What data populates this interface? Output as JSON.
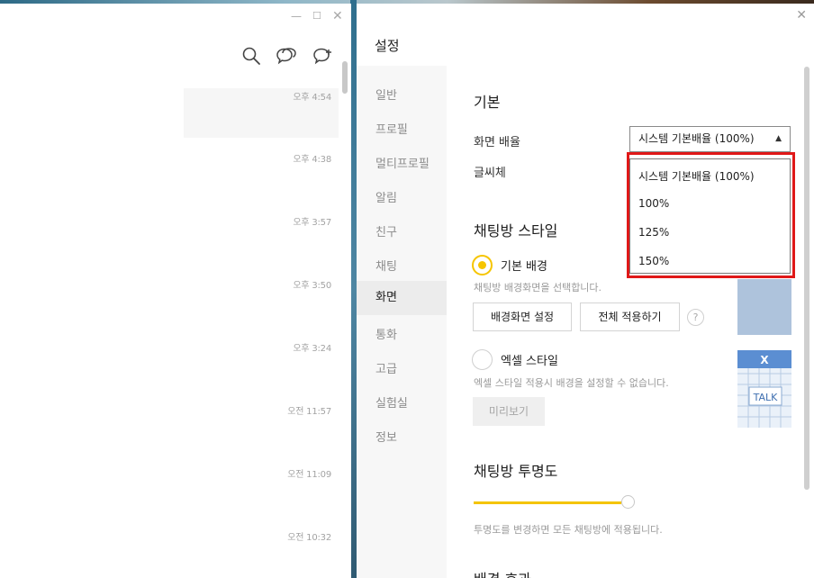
{
  "chat_window": {
    "controls": {
      "minimize": "—",
      "maximize": "☐",
      "close": "✕"
    },
    "toolbar_icons": [
      "search-icon",
      "openchat-icon",
      "new-chat-icon"
    ],
    "times": [
      "오후 4:54",
      "오후 4:38",
      "오후 3:57",
      "오후 3:50",
      "오후 3:24",
      "오전 11:57",
      "오전 11:09",
      "오전 10:32"
    ]
  },
  "settings": {
    "title": "설정",
    "close": "✕",
    "sidebar": [
      "일반",
      "프로필",
      "멀티프로필",
      "알림",
      "친구",
      "채팅",
      "화면",
      "통화",
      "고급",
      "실험실",
      "정보"
    ],
    "active_item": "화면",
    "basic": {
      "title": "기본",
      "zoom_label": "화면 배율",
      "zoom_value": "시스템 기본배율 (100%)",
      "zoom_arrow": "▲",
      "zoom_options": [
        "시스템 기본배율 (100%)",
        "100%",
        "125%",
        "150%"
      ],
      "font_label": "글씨체"
    },
    "chat_style": {
      "title": "채팅방 스타일",
      "default_bg_label": "기본 배경",
      "default_bg_desc": "채팅방 배경화면을 선택합니다.",
      "set_bg_button": "배경화면 설정",
      "apply_all_button": "전체 적용하기",
      "help": "?",
      "excel_label": "엑셀 스타일",
      "excel_desc": "엑셀 스타일 적용시 배경을 설정할 수 없습니다.",
      "preview_button": "미리보기",
      "excel_thumb_text": {
        "x": "X",
        "talk": "TALK"
      }
    },
    "transparency": {
      "title": "채팅방 투명도",
      "level": 0.0,
      "desc": "투명도를 변경하면 모든 채팅방에 적용됩니다."
    },
    "bg_effect": {
      "title": "배경 효과"
    }
  },
  "colors": {
    "accent_yellow": "#f6c500",
    "highlight_red": "#e01818"
  }
}
